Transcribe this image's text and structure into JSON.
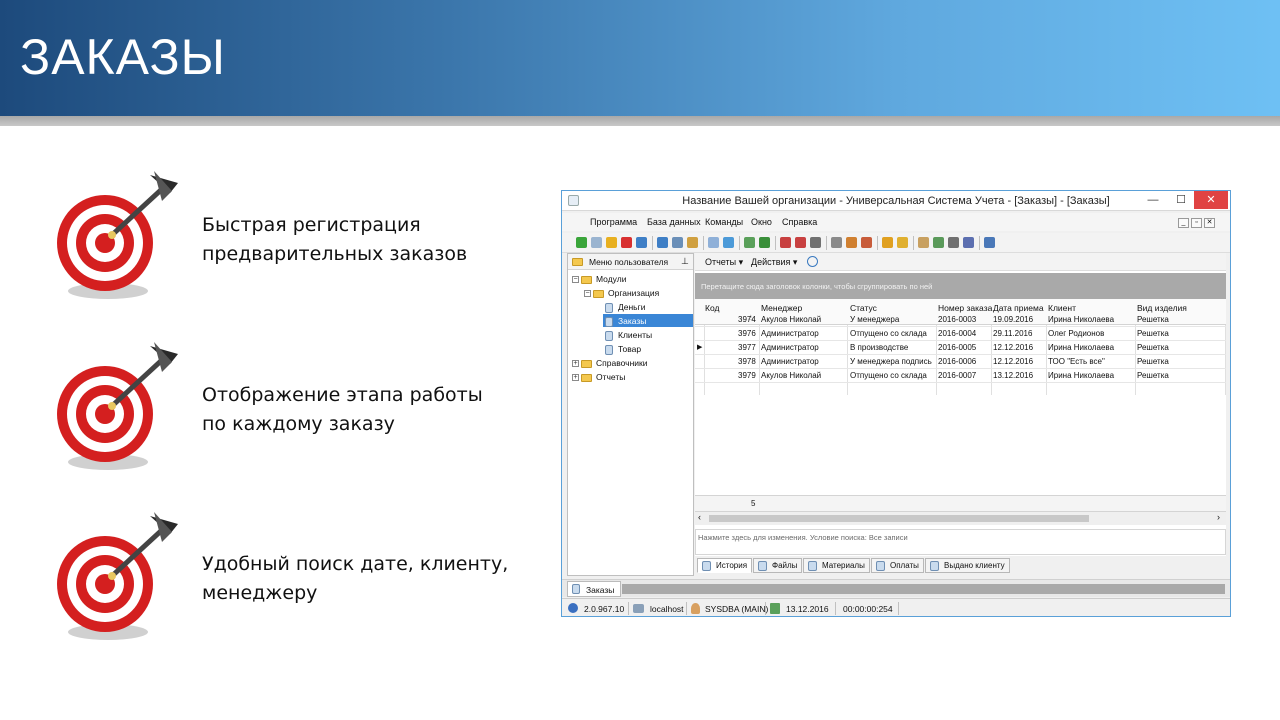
{
  "slide": {
    "title": "ЗАКАЗЫ",
    "features": [
      {
        "line1": "Быстрая регистрация",
        "line2": "предварительных заказов"
      },
      {
        "line1": "Отображение этапа работы",
        "line2": "по каждому заказу"
      },
      {
        "line1": "Удобный поиск дате, клиенту,",
        "line2": "менеджеру"
      }
    ],
    "icon": "target-dart-icon"
  },
  "window": {
    "title": "Название Вашей организации - Универсальная Система Учета - [Заказы] - [Заказы]",
    "controls": {
      "minimize": "—",
      "maximize": "☐",
      "close": "✕"
    },
    "menu": [
      "Программа",
      "База данных",
      "Команды",
      "Окно",
      "Справка"
    ],
    "mdi_controls": [
      "_",
      "▫",
      "✕"
    ],
    "toolbar_colors": [
      "#3aa53a",
      "#9ab4d0",
      "#e8b020",
      "#d83030",
      "#3f7fc6",
      "#3f7fc6",
      "#6a8fb8",
      "#d0a040",
      "#8fb0d8",
      "#4c9ad8",
      "#5aa05a",
      "#3a8f3a",
      "#c84040",
      "#c84040",
      "#707070",
      "#8a8a8a",
      "#d08030",
      "#c85c3a",
      "#e0a020",
      "#e0b030",
      "#c8a060",
      "#5a9a5a",
      "#707070",
      "#5c6fb0",
      "#4a78b8"
    ]
  },
  "left_panel": {
    "header": "Меню пользователя",
    "pin_icon": "pin-icon",
    "tree": [
      {
        "label": "Модули",
        "expander": "−"
      },
      {
        "label": "Организация",
        "expander": "−"
      },
      {
        "label": "Деньги"
      },
      {
        "label": "Заказы"
      },
      {
        "label": "Клиенты"
      },
      {
        "label": "Товар"
      },
      {
        "label": "Справочники",
        "expander": "+"
      },
      {
        "label": "Отчеты",
        "expander": "+"
      }
    ]
  },
  "grid_toolbar": {
    "reports": "Отчеты ▾",
    "actions": "Действия ▾"
  },
  "group_hint": "Перетащите сюда заголовок колонки, чтобы сгруппировать по ней",
  "columns": [
    "Код",
    "Менеджер",
    "Статус",
    "Номер заказа",
    "Дата приема",
    "Клиент",
    "Вид изделия"
  ],
  "sort_indicator": "△",
  "rows": [
    {
      "code": "3974",
      "manager": "Акулов Николай",
      "status": "У менеджера",
      "number": "2016-0003",
      "date": "19.09.2016",
      "client": "Ирина Николаева",
      "product": "Решетка"
    },
    {
      "code": "3976",
      "manager": "Администратор",
      "status": "Отпущено со склада",
      "number": "2016-0004",
      "date": "29.11.2016",
      "client": "Олег Родионов",
      "product": "Решетка"
    },
    {
      "code": "3977",
      "manager": "Администратор",
      "status": "В производстве",
      "number": "2016-0005",
      "date": "12.12.2016",
      "client": "Ирина Николаева",
      "product": "Решетка"
    },
    {
      "code": "3978",
      "manager": "Администратор",
      "status": "У менеджера подпись",
      "number": "2016-0006",
      "date": "12.12.2016",
      "client": "ТОО \"Есть все\"",
      "product": "Решетка"
    },
    {
      "code": "3979",
      "manager": "Акулов Николай",
      "status": "Отпущено со склада",
      "number": "2016-0007",
      "date": "13.12.2016",
      "client": "Ирина Николаева",
      "product": "Решетка"
    }
  ],
  "current_row_marker": "▶",
  "footer_count": "5",
  "filter_hint": "Нажмите здесь для изменения. Условие поиска: Все записи",
  "detail_tabs": [
    "История",
    "Файлы",
    "Материалы",
    "Оплаты",
    "Выдано клиенту"
  ],
  "doc_tab": "Заказы",
  "status": {
    "version": "2.0.967.10",
    "host": "localhost",
    "user": "SYSDBA (MAIN)",
    "date": "13.12.2016",
    "timer": "00:00:00:254"
  }
}
